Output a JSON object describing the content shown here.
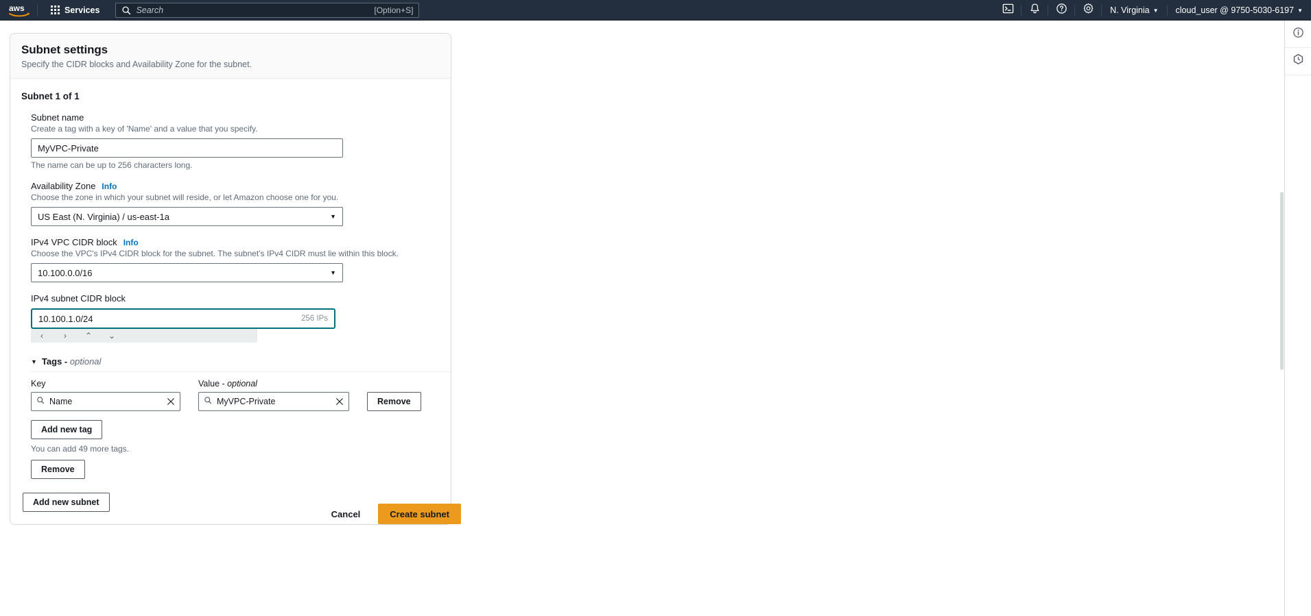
{
  "topnav": {
    "logo_alt": "aws",
    "services_label": "Services",
    "search_placeholder": "Search",
    "search_value": "",
    "search_shortcut": "[Option+S]",
    "cloudshell_icon": "cloudshell-icon",
    "notifications_icon": "bell-icon",
    "help_icon": "question-circle-icon",
    "settings_icon": "gear-icon",
    "region_label": "N. Virginia",
    "account_label": "cloud_user @ 9750-5030-6197"
  },
  "card": {
    "title": "Subnet settings",
    "subtitle": "Specify the CIDR blocks and Availability Zone for the subnet.",
    "subnet_heading": "Subnet 1 of 1"
  },
  "fields": {
    "subnet_name": {
      "label": "Subnet name",
      "description": "Create a tag with a key of 'Name' and a value that you specify.",
      "value": "MyVPC-Private",
      "hint": "The name can be up to 256 characters long."
    },
    "availability_zone": {
      "label": "Availability Zone",
      "info": "Info",
      "description": "Choose the zone in which your subnet will reside, or let Amazon choose one for you.",
      "value": "US East (N. Virginia) / us-east-1a"
    },
    "vpc_cidr": {
      "label": "IPv4 VPC CIDR block",
      "info": "Info",
      "description": "Choose the VPC's IPv4 CIDR block for the subnet. The subnet's IPv4 CIDR must lie within this block.",
      "value": "10.100.0.0/16"
    },
    "subnet_cidr": {
      "label": "IPv4 subnet CIDR block",
      "value": "10.100.1.0/24",
      "ip_count": "256 IPs",
      "nav": {
        "prev": "‹",
        "next": "›",
        "up": "⌃",
        "down": "⌄"
      }
    }
  },
  "tags": {
    "section_title": "Tags -",
    "section_optional": "optional",
    "key_label": "Key",
    "value_label": "Value -",
    "value_optional": "optional",
    "rows": [
      {
        "key": "Name",
        "value": "MyVPC-Private",
        "remove_label": "Remove"
      }
    ],
    "add_tag_label": "Add new tag",
    "more_tags_hint": "You can add 49 more tags."
  },
  "buttons": {
    "remove_subnet_label": "Remove",
    "add_subnet_label": "Add new subnet",
    "cancel_label": "Cancel",
    "create_label": "Create subnet"
  },
  "rail": {
    "info_icon": "info-circle-icon",
    "shortcut_icon": "hexagon-clock-icon"
  },
  "colors": {
    "nav_bg": "#232f3e",
    "primary": "#ec9a1e",
    "focus_border": "#00707e",
    "link": "#0073bb"
  }
}
